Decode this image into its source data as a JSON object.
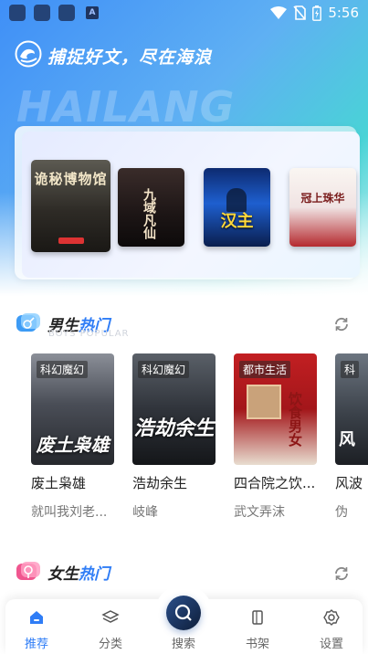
{
  "status": {
    "time": "5:56",
    "notif_letter": "A"
  },
  "header": {
    "slogan": "捕捉好文，尽在海浪",
    "watermark": "HAILANG"
  },
  "banner": {
    "books": [
      {
        "title": "诡秘博物馆"
      },
      {
        "title": "九域凡仙"
      },
      {
        "title": "汉主"
      },
      {
        "title": "冠上珠华"
      }
    ]
  },
  "male_section": {
    "title_a": "男生",
    "title_b": "热门",
    "subtitle": "BOYS POPULAR",
    "books": [
      {
        "genre": "科幻魔幻",
        "cover_text": "废土枭雄",
        "title": "废土枭雄",
        "author": "就叫我刘老..."
      },
      {
        "genre": "科幻魔幻",
        "cover_text": "浩劫余生",
        "title": "浩劫余生",
        "author": "岐峰"
      },
      {
        "genre": "都市生活",
        "cover_text": "饮食男女",
        "title": "四合院之饮...",
        "author": "武文弄沫"
      },
      {
        "genre": "科",
        "cover_text": "风",
        "title": "风波",
        "author": "伪"
      }
    ]
  },
  "female_section": {
    "title_a": "女生",
    "title_b": "热门"
  },
  "nav": {
    "items": [
      {
        "label": "推荐",
        "active": true
      },
      {
        "label": "分类"
      },
      {
        "label": "搜索"
      },
      {
        "label": "书架"
      },
      {
        "label": "设置"
      }
    ]
  },
  "colors": {
    "accent": "#2f7df6",
    "hero_start": "#3f8ff7",
    "hero_end": "#49d3d6"
  }
}
